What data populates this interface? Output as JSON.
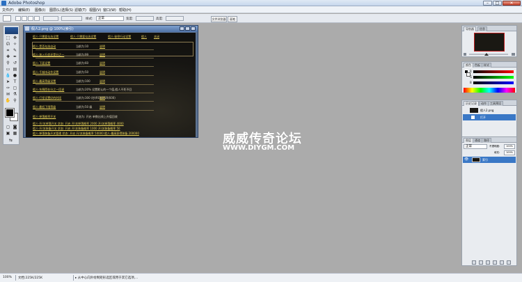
{
  "window": {
    "title": "Adobe Photoshop"
  },
  "menu": [
    "文件(F)",
    "编辑(E)",
    "图像(I)",
    "图层(L)",
    "选择(S)",
    "滤镜(T)",
    "视图(V)",
    "窗口(W)",
    "帮助(H)"
  ],
  "options": {
    "style_label": "样式:",
    "style_value": "正常",
    "width_label": "宽度:",
    "height_label": "高度:"
  },
  "well_tabs": [
    "文件浏览器",
    "画笔"
  ],
  "document": {
    "title": "假人2.png @ 100%(索引)",
    "header_links": [
      "假人·只需要勾选设置",
      "假人·只需要勾选设置",
      "假人·秘密行动设置",
      "假人",
      "关闭"
    ],
    "rows": [
      {
        "link": "假人·是否勾选自动",
        "label": "当前为:",
        "value": "10",
        "action": "说明"
      },
      {
        "link": "假人·加入行会还是分之一",
        "label": "当前为:",
        "value": "99",
        "action": "说明"
      },
      {
        "link": "假人·下面设置",
        "label": "当前为:",
        "value": "60",
        "action": "说明"
      },
      {
        "link": "假人·千城市动作设置",
        "label": "当前为:",
        "value": "50",
        "action": "说明"
      },
      {
        "link": "假人·最高等级设置",
        "label": "当前为:",
        "value": "100",
        "action": "说明"
      },
      {
        "link": "假人·东倒西在分之一回退",
        "label": "当前为:",
        "value": "20% 设置默认的一个值,假人不死不回",
        "action": ""
      },
      {
        "link": "假人·打怪设置好的时间",
        "label": "当前为:",
        "value": "300 (秒)ROBEGR(600)",
        "action": "说明"
      },
      {
        "link": "假人·最低下限等级",
        "label": "当前为:",
        "value": "50 级",
        "action": "说明"
      }
    ],
    "switch_row": {
      "link": "假人·掉落概率开关",
      "text": "状态为: 开启 单数出线上升值回收"
    },
    "bottom_rows": [
      "假人·开/关掉落开关  状态: 开启  开/关掉落概率 2000  开/关掉落概率 4000",
      "假人·开/关装备开关  状态: 开启  开/关装备概率 1000  开/关装备概率 50",
      "假人·掉落装备开关管理  状态: 开启  开/关装备概率 50000  假人·最高获得装备 200000"
    ]
  },
  "panels": {
    "navigator_tabs": [
      "导航器",
      "信息"
    ],
    "color_tabs": [
      "颜色",
      "色板",
      "样式"
    ],
    "color_labels": [
      "R",
      "G",
      "B"
    ],
    "history_tabs": [
      "历史记录",
      "动作",
      "工具预设"
    ],
    "history_items": [
      "假人2.png",
      "打开"
    ],
    "layers_tabs": [
      "图层",
      "通道",
      "路径"
    ],
    "layers_mode": "正常",
    "opacity_label": "不透明度:",
    "opacity_value": "100%",
    "fill_label": "填充:",
    "fill_value": "100%",
    "layer_name": "索引"
  },
  "watermark": {
    "title": "威威传奇论坛",
    "url": "WWW.DIYGM.COM"
  },
  "status": {
    "zoom": "100%",
    "doc_size": "文档:225K/225K",
    "hint": "▸ 从中心向外绘制矩形选区或用于其它选项,..."
  }
}
